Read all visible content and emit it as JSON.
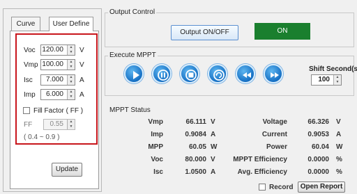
{
  "tabs": {
    "curve": "Curve",
    "user_define": "User Define"
  },
  "params": {
    "voc": {
      "label": "Voc",
      "value": "120.00",
      "unit": "V"
    },
    "vmp": {
      "label": "Vmp",
      "value": "100.00",
      "unit": "V"
    },
    "isc": {
      "label": "Isc",
      "value": "7.000",
      "unit": "A"
    },
    "imp": {
      "label": "Imp",
      "value": "6.000",
      "unit": "A"
    },
    "fill_factor_label": "Fill Factor ( FF )",
    "ff_label": "FF",
    "ff_value": "0.55",
    "ff_range": "( 0.4 ~ 0.9 )"
  },
  "update_label": "Update",
  "output_control": {
    "title": "Output Control",
    "button": "Output ON/OFF",
    "status": "ON"
  },
  "execute_mppt": {
    "title": "Execute MPPT",
    "shift_label": "Shift Second(s)",
    "shift_value": "100"
  },
  "mppt_status": {
    "title": "MPPT Status",
    "left": [
      {
        "label": "Vmp",
        "value": "66.111",
        "unit": "V"
      },
      {
        "label": "Imp",
        "value": "0.9084",
        "unit": "A"
      },
      {
        "label": "MPP",
        "value": "60.05",
        "unit": "W"
      },
      {
        "label": "Voc",
        "value": "80.000",
        "unit": "V"
      },
      {
        "label": "Isc",
        "value": "1.0500",
        "unit": "A"
      }
    ],
    "right": [
      {
        "label": "Voltage",
        "value": "66.326",
        "unit": "V"
      },
      {
        "label": "Current",
        "value": "0.9053",
        "unit": "A"
      },
      {
        "label": "Power",
        "value": "60.04",
        "unit": "W"
      },
      {
        "label": "MPPT Efficiency",
        "value": "0.0000",
        "unit": "%"
      },
      {
        "label": "Avg. Efficiency",
        "value": "0.0000",
        "unit": "%"
      }
    ]
  },
  "record_label": "Record",
  "open_report_label": "Open Report",
  "icons": [
    "play-icon",
    "pause-icon",
    "stop-icon",
    "refresh-icon",
    "rewind-icon",
    "fast-forward-icon"
  ]
}
